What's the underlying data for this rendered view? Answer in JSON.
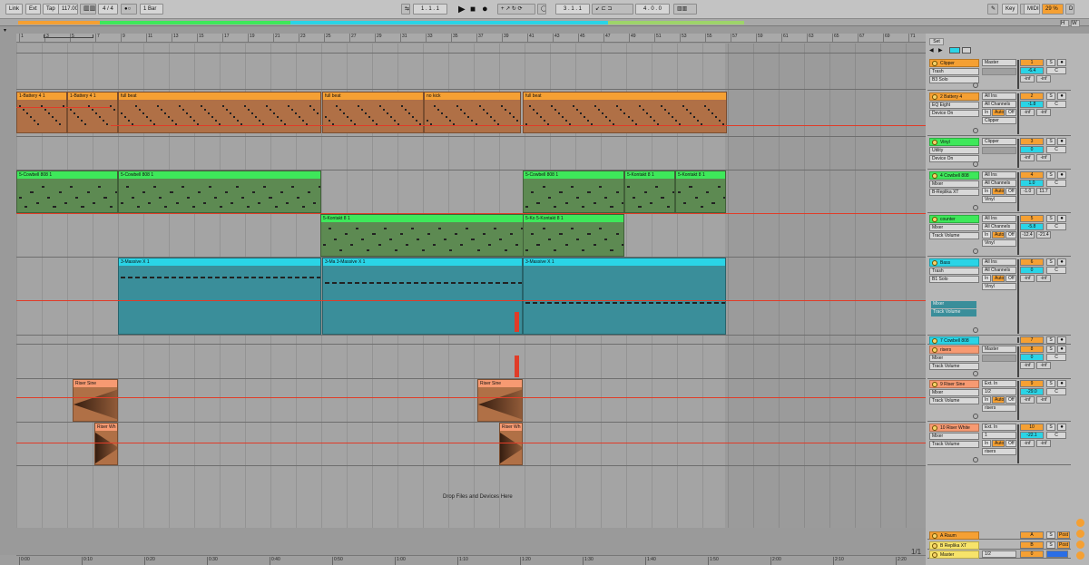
{
  "transport": {
    "link": "Link",
    "ext": "Ext",
    "tap": "Tap",
    "tempo": "117.00",
    "sig": "4 / 4",
    "quant": "1 Bar",
    "pos": "1 .  1 .  1",
    "loop_start": "3 .  1 .  1",
    "loop_len": "4 .  0 .  0",
    "key": "Key",
    "midi": "MIDI",
    "cpu": "29 %",
    "io_d": "D",
    "io_h": "H",
    "io_w": "W"
  },
  "ruler": {
    "bars": [
      "1",
      "3",
      "5",
      "7",
      "9",
      "11",
      "13",
      "15",
      "17",
      "19",
      "21",
      "23",
      "25",
      "27",
      "29",
      "31",
      "33",
      "35",
      "37",
      "39",
      "41",
      "43",
      "45",
      "47",
      "49",
      "51",
      "53",
      "55",
      "57",
      "59",
      "61",
      "63",
      "65",
      "67",
      "69",
      "71"
    ]
  },
  "timebar": {
    "times": [
      "0:00",
      "0:10",
      "0:20",
      "0:30",
      "0:40",
      "0:50",
      "1:00",
      "1:10",
      "1:20",
      "1:30",
      "1:40",
      "1:50",
      "2:00",
      "2:10",
      "2:20"
    ]
  },
  "set_label": "Set",
  "drop_label": "Drop Files and Devices Here",
  "fraction": "1/1",
  "clips": {
    "battery": [
      {
        "name": "1-Battery 4 1"
      },
      {
        "name": "1-Battery 4 1"
      },
      {
        "name": "full beat"
      },
      {
        "name": "full beat"
      },
      {
        "name": "no kick"
      },
      {
        "name": "full beat"
      }
    ],
    "cowbell": [
      {
        "name": "5-Cowbell 808 1"
      },
      {
        "name": "5-Cowbell 808 1"
      },
      {
        "name": "5-Cowbell 808 1"
      },
      {
        "name": "5-Kontakt 8 1"
      },
      {
        "name": "5-Kontakt 8 1"
      }
    ],
    "kontakt": [
      {
        "name": "5-Kontakt 8 1"
      },
      {
        "name": "5-Ko 5-Kontakt 8 1"
      }
    ],
    "massive": [
      {
        "name": "3-Massive X 1"
      },
      {
        "name": "3-Ma 3-Massive X 1"
      },
      {
        "name": "3-Massive X 1"
      }
    ],
    "riser_sine": [
      {
        "name": "Riser Sine"
      },
      {
        "name": "Riser Sine"
      }
    ],
    "riser_white": [
      {
        "name": "Riser Wh"
      },
      {
        "name": "Riser Wh"
      }
    ]
  },
  "tracks": [
    {
      "name": "Clipper",
      "color": "#f5a033",
      "dev": "Trash",
      "dev2": "B3 Solo",
      "out": "Master",
      "num": "1",
      "vol": "-6.4",
      "pan": "C",
      "inf": "-inf",
      "s": "S"
    },
    {
      "name": "2 Battery 4",
      "color": "#f5a033",
      "dev": "EQ Eight",
      "dev2": "Device On",
      "in": "All Ins",
      "in2": "All Channels",
      "mon_in": "In",
      "mon_auto": "Auto",
      "mon_off": "Off",
      "out": "Clipper",
      "num": "2",
      "vol": "-1.8",
      "pan": "C",
      "inf": "-inf",
      "s": "S"
    },
    {
      "name": "Vinyl",
      "color": "#3ee85a",
      "dev": "Utility",
      "dev2": "Device On",
      "out": "Clipper",
      "num": "3",
      "vol": "0",
      "pan": "C",
      "inf": "-inf",
      "s": "S"
    },
    {
      "name": "4 Cowbell 808",
      "color": "#3ee85a",
      "dev": "Mixer",
      "dev2": "B-Replika XT",
      "in": "All Ins",
      "in2": "All Channels",
      "mon_in": "In",
      "mon_auto": "Auto",
      "mon_off": "Off",
      "out": "Vinyl",
      "num": "4",
      "vol": "1.0",
      "pan": "C",
      "inf": "-1.0",
      "inf2": "11.7",
      "s": "S"
    },
    {
      "name": "counter",
      "color": "#3ee85a",
      "dev": "Mixer",
      "dev2": "Track Volume",
      "in": "All Ins",
      "in2": "All Channels",
      "mon_in": "In",
      "mon_auto": "Auto",
      "mon_off": "Off",
      "out": "Vinyl",
      "num": "5",
      "vol": "-5.8",
      "pan": "C",
      "inf": "-12.4",
      "inf2": "-21.4",
      "s": "S"
    },
    {
      "name": "Bass",
      "color": "#2ad4e6",
      "dev": "Trash",
      "dev2": "B1 Solo",
      "in": "All Ins",
      "in2": "All Channels",
      "mon_in": "In",
      "mon_auto": "Auto",
      "mon_off": "Off",
      "out": "Vinyl",
      "num": "6",
      "vol": "0",
      "pan": "C",
      "inf": "-inf",
      "s": "S",
      "lane": "Mixer",
      "lane2": "Track Volume"
    },
    {
      "name": "7 Cowbell 808",
      "color": "#2ad4e6",
      "num": "7",
      "s": "S"
    },
    {
      "name": "risers",
      "color": "#f79a72",
      "dev": "Mixer",
      "dev2": "Track Volume",
      "out": "Master",
      "num": "8",
      "vol": "0",
      "pan": "C",
      "inf": "-inf",
      "s": "S"
    },
    {
      "name": "9 Riser Sine",
      "color": "#f79a72",
      "dev": "Mixer",
      "dev2": "Track Volume",
      "in": "Ext. In",
      "in2": "1/2",
      "mon_in": "In",
      "mon_auto": "Auto",
      "mon_off": "Off",
      "out": "risers",
      "num": "9",
      "vol": "-29.0",
      "pan": "C",
      "inf": "-inf",
      "s": "S"
    },
    {
      "name": "10 Riser White",
      "color": "#f79a72",
      "dev": "Mixer",
      "dev2": "Track Volume",
      "in": "Ext. In",
      "in2": "1",
      "mon_in": "In",
      "mon_auto": "Auto",
      "mon_off": "Off",
      "out": "risers",
      "num": "10",
      "vol": "-22.1",
      "pan": "C",
      "inf": "-inf",
      "s": "S"
    }
  ],
  "returns": [
    {
      "name": "A Raum",
      "color": "#f5a033",
      "num": "A",
      "s": "S",
      "post": "Post"
    },
    {
      "name": "B Replika XT",
      "color": "#f7e36a",
      "num": "B",
      "s": "S",
      "post": "Post"
    },
    {
      "name": "Master",
      "color": "#f7e36a",
      "out": "1/2",
      "num": "0"
    }
  ]
}
